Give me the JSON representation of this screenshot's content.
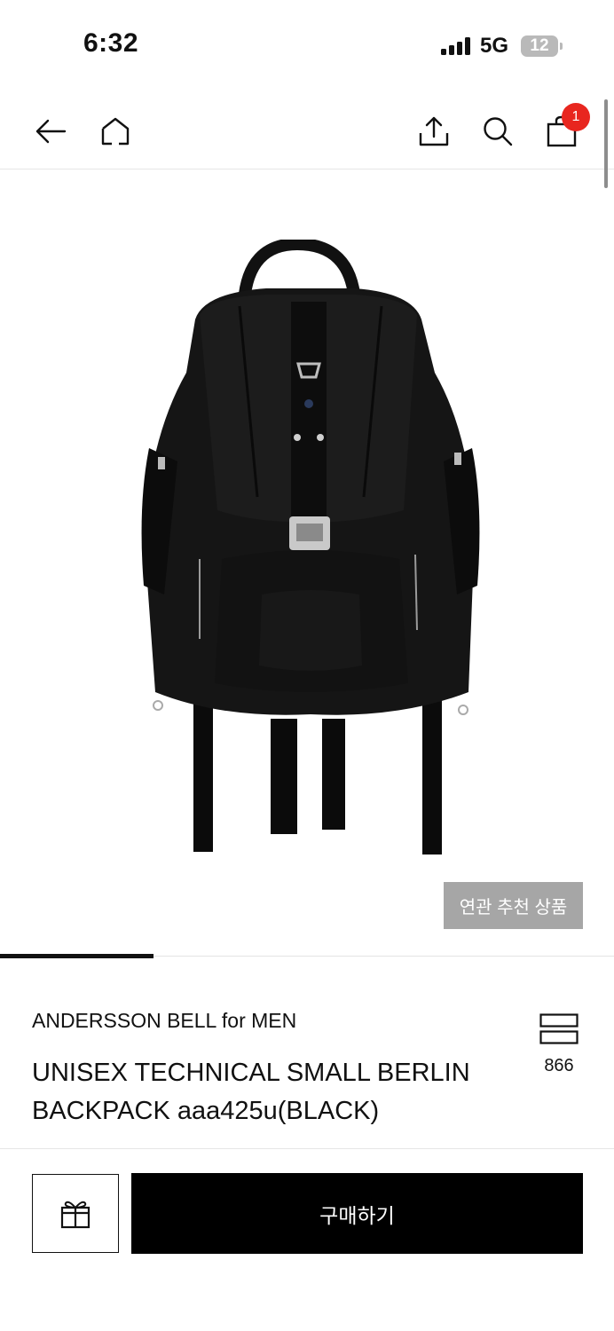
{
  "status_bar": {
    "time": "6:32",
    "network": "5G",
    "battery": "12"
  },
  "header": {
    "back_icon": "arrow-left-icon",
    "home_icon": "home-icon",
    "share_icon": "share-icon",
    "search_icon": "search-icon",
    "cart_icon": "shopping-bag-icon",
    "cart_count": "1"
  },
  "product": {
    "image_alt": "black technical backpack",
    "related_button": "연관 추천 상품",
    "brand": "ANDERSSON BELL for MEN",
    "title": "UNISEX TECHNICAL SMALL BERLIN BACKPACK aaa425u(BLACK)",
    "compare_icon": "compare-icon",
    "compare_count": "866"
  },
  "bottom_bar": {
    "gift_icon": "gift-icon",
    "buy_label": "구매하기"
  },
  "colors": {
    "badge": "#e8261f",
    "buy_button": "#000000",
    "related_button": "#a6a6a6"
  }
}
